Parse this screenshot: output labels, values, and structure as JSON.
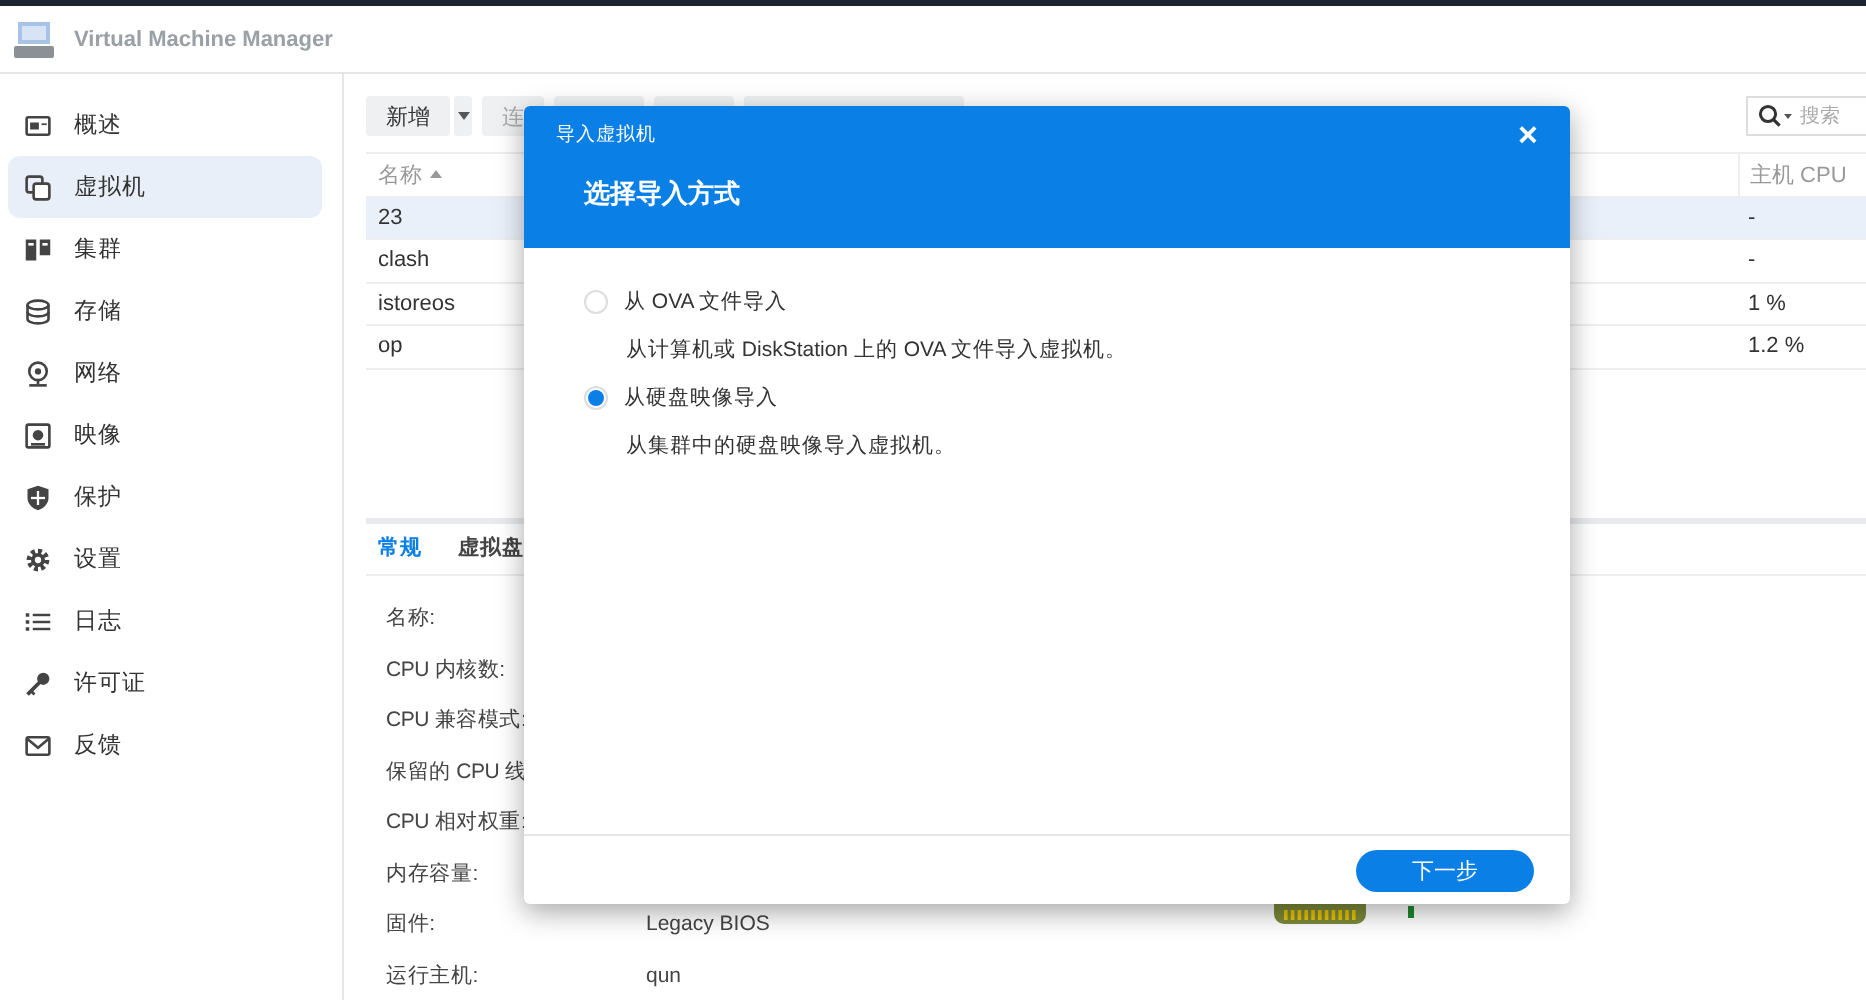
{
  "window": {
    "title": "Virtual Machine Manager"
  },
  "sidebar": {
    "items": [
      {
        "label": "概述",
        "selected": false
      },
      {
        "label": "虚拟机",
        "selected": true
      },
      {
        "label": "集群",
        "selected": false
      },
      {
        "label": "存储",
        "selected": false
      },
      {
        "label": "网络",
        "selected": false
      },
      {
        "label": "映像",
        "selected": false
      },
      {
        "label": "保护",
        "selected": false
      },
      {
        "label": "设置",
        "selected": false
      },
      {
        "label": "日志",
        "selected": false
      },
      {
        "label": "许可证",
        "selected": false
      },
      {
        "label": "反馈",
        "selected": false
      }
    ]
  },
  "toolbar": {
    "buttons": [
      {
        "kind": "split",
        "label": "新增"
      },
      {
        "kind": "plain",
        "label": "连"
      },
      {
        "kind": "covered"
      },
      {
        "kind": "covered"
      },
      {
        "kind": "covered"
      }
    ],
    "search": {
      "placeholder": "搜索"
    }
  },
  "table": {
    "columns": [
      "名称",
      "主机 CPU"
    ],
    "rows": [
      {
        "name": "23",
        "host_cpu": "-",
        "selected": true
      },
      {
        "name": "clash",
        "host_cpu": "-",
        "selected": false
      },
      {
        "name": "istoreos",
        "host_cpu": "1 %",
        "selected": false
      },
      {
        "name": "op",
        "host_cpu": "1.2 %",
        "selected": false
      }
    ]
  },
  "details": {
    "tabs": [
      {
        "label": "常规",
        "selected": true
      },
      {
        "label": "虚拟盘",
        "selected": false
      }
    ],
    "fields": [
      {
        "label": "名称:"
      },
      {
        "label": "CPU 内核数:"
      },
      {
        "label": "CPU 兼容模式:"
      },
      {
        "label": "保留的 CPU 线"
      },
      {
        "label": "CPU 相对权重:"
      },
      {
        "label": "内存容量:"
      },
      {
        "label": "固件:",
        "value": "Legacy BIOS"
      },
      {
        "label": "运行主机:",
        "value": "qun"
      }
    ]
  },
  "dialog": {
    "title": "导入虚拟机",
    "heading": "选择导入方式",
    "close": "×",
    "options": [
      {
        "label": "从 OVA 文件导入",
        "description": "从计算机或 DiskStation 上的 OVA 文件导入虚拟机。",
        "selected": false
      },
      {
        "label": "从硬盘映像导入",
        "description": "从集群中的硬盘映像导入虚拟机。",
        "selected": true
      }
    ],
    "button": "下一步"
  }
}
